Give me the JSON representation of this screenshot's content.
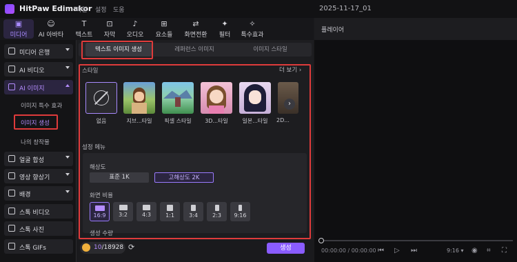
{
  "app": {
    "title": "HitPaw Edimakor",
    "menus": [
      "파일",
      "설정",
      "도움"
    ],
    "project_name": "2025-11-17_01"
  },
  "toolbar": {
    "items": [
      {
        "label": "미디어",
        "icon": "media-icon"
      },
      {
        "label": "AI 아바타",
        "icon": "avatar-icon"
      },
      {
        "label": "텍스트",
        "icon": "text-icon"
      },
      {
        "label": "자막",
        "icon": "subtitle-icon"
      },
      {
        "label": "오디오",
        "icon": "audio-icon"
      },
      {
        "label": "요소들",
        "icon": "elements-icon"
      },
      {
        "label": "화면전환",
        "icon": "transition-icon"
      },
      {
        "label": "필터",
        "icon": "filter-icon"
      },
      {
        "label": "특수효과",
        "icon": "effects-icon"
      }
    ]
  },
  "sidebar": {
    "items": [
      {
        "label": "미디어 은행"
      },
      {
        "label": "AI 비디오"
      },
      {
        "label": "AI 이미지"
      },
      {
        "label": "얼굴 합성"
      },
      {
        "label": "영상 향상기"
      },
      {
        "label": "배경"
      },
      {
        "label": "스톡 비디오"
      },
      {
        "label": "스톡 사진"
      },
      {
        "label": "스톡 GIFs"
      }
    ],
    "sub_items": [
      "이미지 특수 효과",
      "이미지 생성",
      "나의 창작물"
    ]
  },
  "main": {
    "tabs": [
      "텍스트 이미지 생성",
      "레퍼런스 이미지",
      "이미지 스타일"
    ],
    "style_label": "스타일",
    "more_label": "더 보기",
    "styles": [
      "없음",
      "지브...타일",
      "픽셀 스타일",
      "3D...타일",
      "일본...타일",
      "2D..."
    ],
    "settings_label": "설정 메뉴",
    "resolution_label": "해상도",
    "resolutions": [
      "표준 1K",
      "고해상도 2K"
    ],
    "ratio_label": "화면 비율",
    "ratios": [
      "16:9",
      "3:2",
      "4:3",
      "1:1",
      "3:4",
      "2:3",
      "9:16"
    ],
    "count_label": "생성 수량",
    "credits_used": "10",
    "credits_total": "/18928",
    "generate_label": "생성"
  },
  "player": {
    "title": "플레이어",
    "timecode": "00:00:00 / 00:00:00",
    "ratio": "9:16"
  },
  "colors": {
    "accent": "#8a5cff",
    "highlight": "#e03b3b"
  }
}
